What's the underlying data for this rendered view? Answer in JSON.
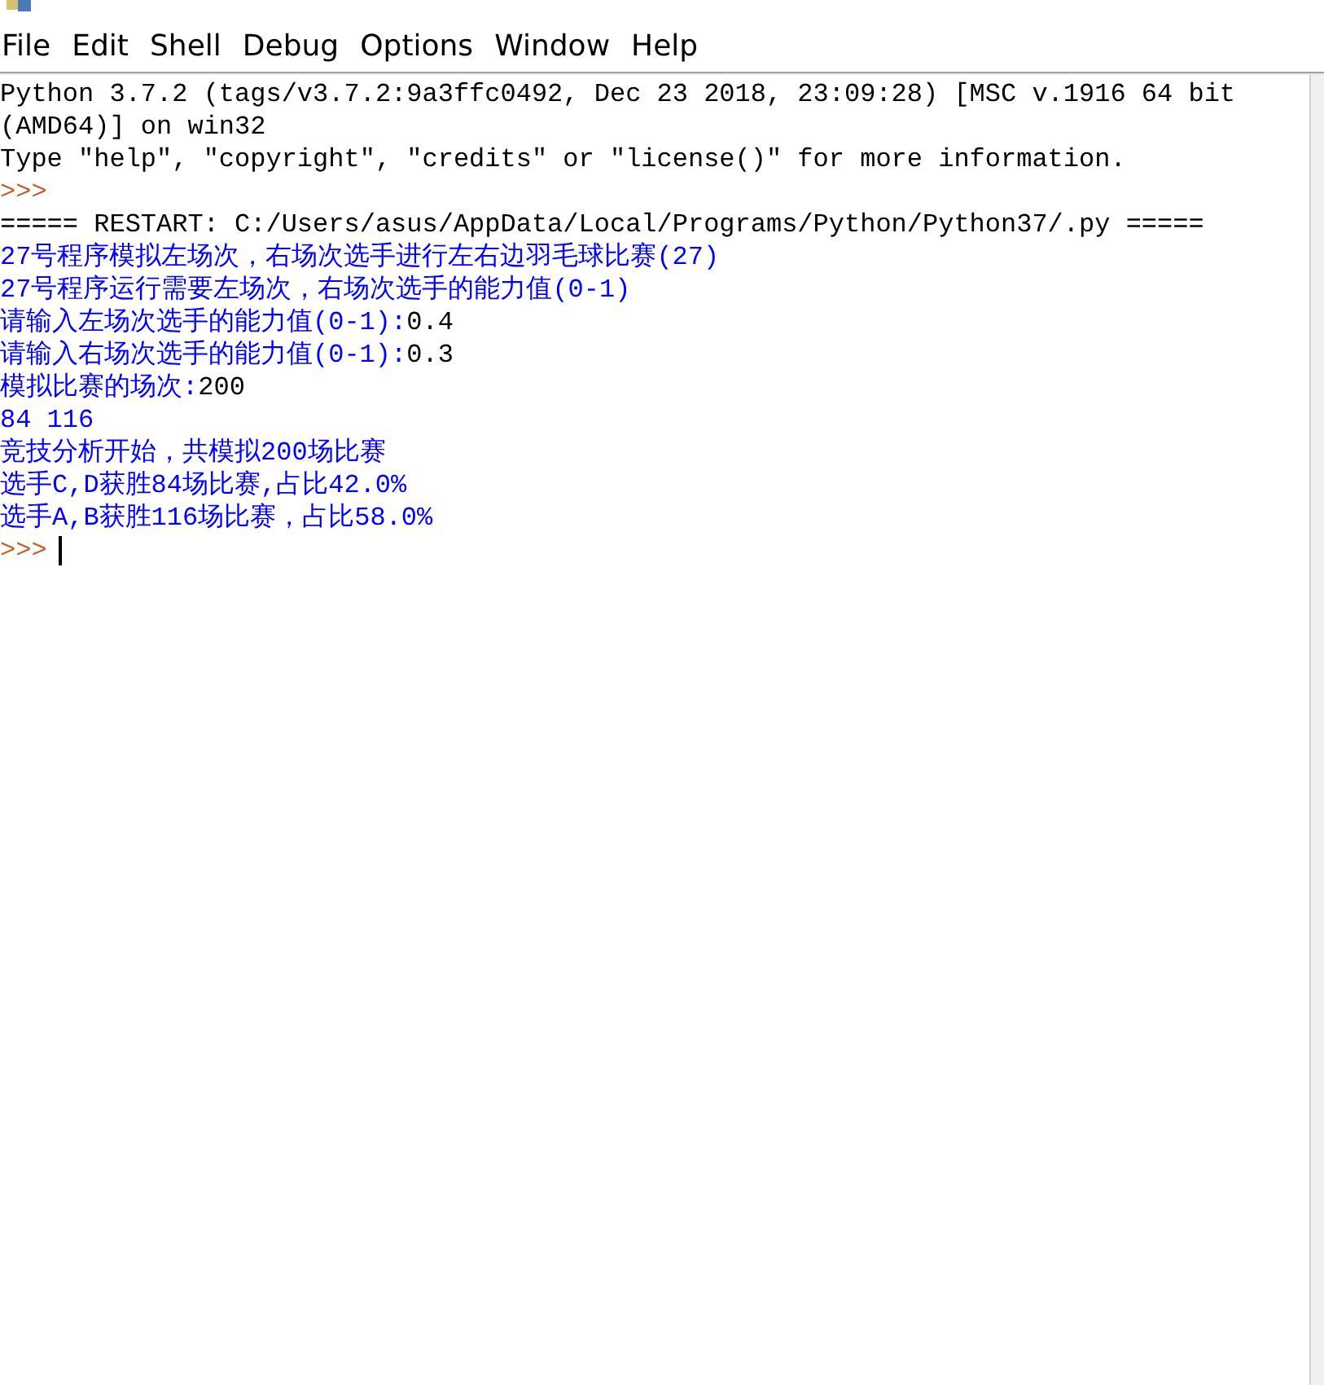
{
  "menu": [
    "File",
    "Edit",
    "Shell",
    "Debug",
    "Options",
    "Window",
    "Help"
  ],
  "shell_lines": [
    {
      "kind": "stdout",
      "text": "Python 3.7.2 (tags/v3.7.2:9a3ffc0492, Dec 23 2018, 23:09:28) [MSC v.1916 64 bit"
    },
    {
      "kind": "stdout",
      "text": "(AMD64)] on win32"
    },
    {
      "kind": "stdout",
      "text": "Type \"help\", \"copyright\", \"credits\" or \"license()\" for more information."
    },
    {
      "kind": "prompt",
      "text": ">>>"
    },
    {
      "kind": "stdout",
      "text": "===== RESTART: C:/Users/asus/AppData/Local/Programs/Python/Python37/.py ====="
    },
    {
      "kind": "output",
      "text": "27号程序模拟左场次，右场次选手进行左右边羽毛球比赛(27)"
    },
    {
      "kind": "output",
      "text": "27号程序运行需要左场次，右场次选手的能力值(0-1)"
    },
    {
      "kind": "output",
      "text": "请输入左场次选手的能力值(0-1):",
      "input": "0.4"
    },
    {
      "kind": "output",
      "text": "请输入右场次选手的能力值(0-1):",
      "input": "0.3"
    },
    {
      "kind": "output",
      "text": "模拟比赛的场次:",
      "input": "200"
    },
    {
      "kind": "output",
      "text": "84 116"
    },
    {
      "kind": "output",
      "text": "竞技分析开始，共模拟200场比赛"
    },
    {
      "kind": "output",
      "text": "选手C,D获胜84场比赛,占比42.0%"
    },
    {
      "kind": "output",
      "text": "选手A,B获胜116场比赛，占比58.0%"
    },
    {
      "kind": "prompt",
      "text": ">>>",
      "cursor": true
    }
  ]
}
